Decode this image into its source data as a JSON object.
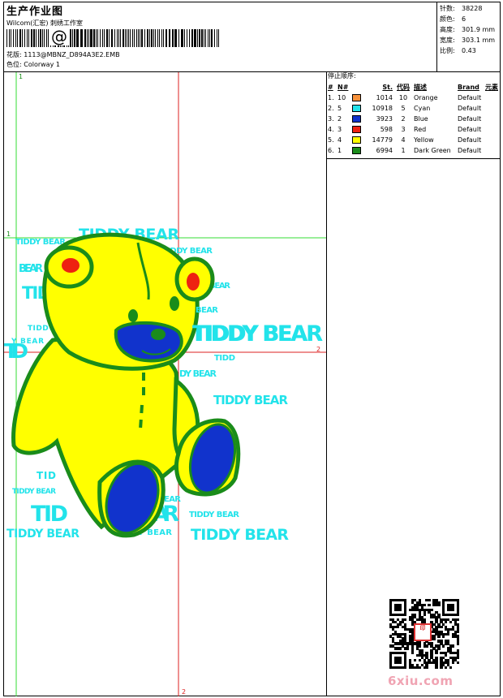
{
  "header": {
    "title": "生产作业图",
    "company": "Wilcom(汇宏) 刺绣工作室",
    "barcode_symbol": "@",
    "design_label": "花版:",
    "design_name": "1113@MBNZ_D894A3E2.EMB",
    "colorway_label": "色位:",
    "colorway_name": "Colorway 1"
  },
  "stats": [
    {
      "label": "针数:",
      "value": "38228"
    },
    {
      "label": "颜色:",
      "value": "6"
    },
    {
      "label": "高度:",
      "value": "301.9 mm"
    },
    {
      "label": "宽度:",
      "value": "303.1 mm"
    },
    {
      "label": "比例:",
      "value": "0.43"
    }
  ],
  "sequence": {
    "title": "停止顺序:",
    "headers": [
      "#",
      "N#",
      "St.",
      "代码",
      "描述",
      "Brand",
      "元素"
    ],
    "rows": [
      {
        "idx": "1.",
        "n": "10",
        "color": "#f7913a",
        "st": "1014",
        "code": "10",
        "desc": "Orange",
        "brand": "Default"
      },
      {
        "idx": "2.",
        "n": "5",
        "color": "#22e3ea",
        "st": "10918",
        "code": "5",
        "desc": "Cyan",
        "brand": "Default"
      },
      {
        "idx": "3.",
        "n": "2",
        "color": "#1133cc",
        "st": "3923",
        "code": "2",
        "desc": "Blue",
        "brand": "Default"
      },
      {
        "idx": "4.",
        "n": "3",
        "color": "#ee2211",
        "st": "598",
        "code": "3",
        "desc": "Red",
        "brand": "Default"
      },
      {
        "idx": "5.",
        "n": "4",
        "color": "#ffff00",
        "st": "14779",
        "code": "4",
        "desc": "Yellow",
        "brand": "Default"
      },
      {
        "idx": "6.",
        "n": "1",
        "color": "#1a8c1a",
        "st": "6994",
        "code": "1",
        "desc": "Dark Green",
        "brand": "Default"
      }
    ]
  },
  "canvas": {
    "guide_labels": {
      "green_v": "1",
      "green_h": "1",
      "red_h": "2",
      "red_v": "2"
    },
    "texts": {
      "t1": "TIDDY BEAR",
      "t2": "TIDDY BEAR",
      "t3": "TIDDY BEAR",
      "t4": "BEAR",
      "t5": "TID",
      "t6": "BEAR",
      "t7": "TIDDY BEAR",
      "t8": "TIDDY",
      "t9": "Y BEAR",
      "t10": "TIDD",
      "t11": "DY BEAR",
      "t12": "TIDDY BEAR",
      "t13": "TIDDY BEAR",
      "t14": "TID",
      "t15": "TIDDY BEAR",
      "t16": "TID",
      "t17": "BEAR",
      "t18": "BEAR",
      "t19": "TIDDY BEAR",
      "t20": "TIDDY BEAR",
      "t21": "DY BEAR",
      "t22": "TIDDY BEAR",
      "t23": "BEAR",
      "t24": "TID"
    },
    "colors": {
      "text": "#22e3ea",
      "bear": "#ffff00",
      "outline": "#1a8c1a",
      "ear": "#ee2211",
      "blue": "#1133cc",
      "guide_green": "#33dd33",
      "guide_red": "#dd2222"
    }
  },
  "qr": {
    "stamp_text": "印",
    "watermark": "6xiu.com"
  }
}
